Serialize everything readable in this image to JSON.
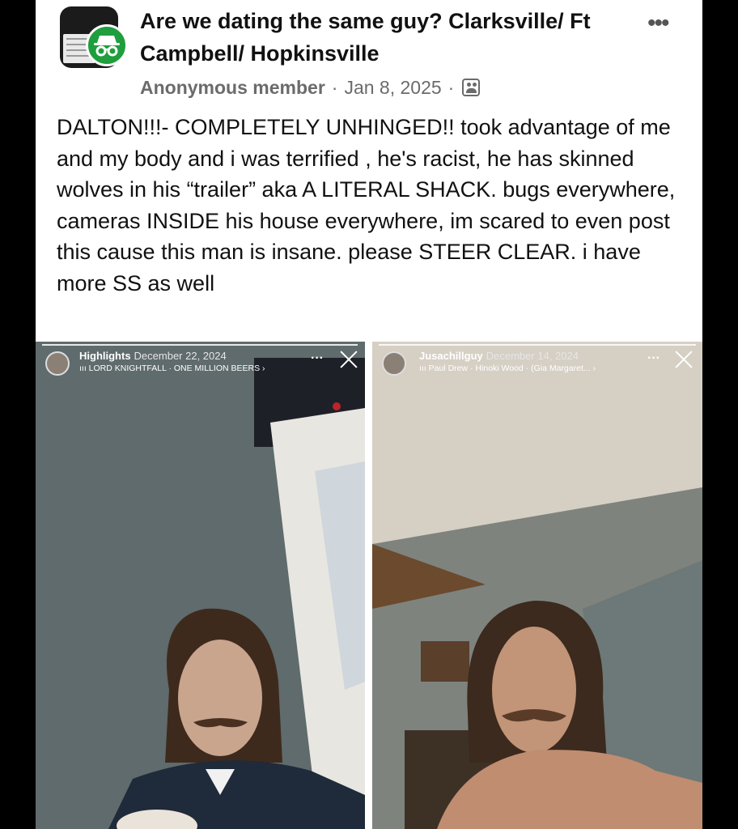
{
  "group": {
    "title": "Are we dating the same guy? Clarksville/ Ft Campbell/ Hopkinsville",
    "avatar_icon": "incognito-icon"
  },
  "post": {
    "author": "Anonymous member",
    "separator": "·",
    "date": "Jan 8, 2025",
    "audience_icon": "group-members-icon",
    "body": "DALTON!!!- COMPLETELY UNHINGED!! took advantage of me and my body and i was terrified , he's racist, he has skinned wolves in his “trailer” aka A LITERAL SHACK. bugs everywhere, cameras INSIDE his house everywhere, im scared to even post this cause this man is insane. please STEER CLEAR. i have more SS as well",
    "more_icon": "more-options-icon"
  },
  "stories": [
    {
      "user": "Highlights",
      "date": "December 22, 2024",
      "music": "ııı LORD KNIGHTFALL · ONE MILLION BEERS ›",
      "dots": "···",
      "close_icon": "close-icon"
    },
    {
      "user": "Jusachillguy",
      "date": "December 14, 2024",
      "music": "ııı Paul Drew · Hinoki Wood · (Gia Margaret... ›",
      "dots": "···",
      "close_icon": "close-icon"
    }
  ],
  "colors": {
    "badge_green": "#1f9e3d",
    "meta_gray": "#6b6b6b",
    "text": "#111111"
  }
}
